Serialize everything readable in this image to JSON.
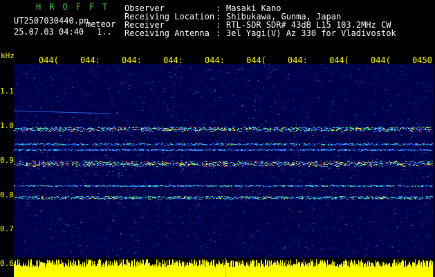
{
  "header": {
    "title": "HROFFT",
    "filename": "UT2507030440.pn",
    "filename_suffix": "meteor",
    "datetime": "25.07.03 04:40",
    "count": "1..",
    "info": [
      {
        "label": "Observer",
        "value": "Masaki Kano"
      },
      {
        "label": "Receiving Location",
        "value": "Shibukawa, Gunma, Japan"
      },
      {
        "label": "Receiver",
        "value": "RTL-SDR SDR# 43dB L15 103.2MHz CW"
      },
      {
        "label": "Receiving Antenna",
        "value": "3el Yagi(V) Az 330 for Vladivostok"
      }
    ]
  },
  "axis": {
    "y_unit": "kHz",
    "y_ticks": [
      "1.1",
      "1.0",
      "0.9",
      "0.8",
      "0.7",
      "0.6"
    ],
    "x_ticks": [
      "044(",
      "044:",
      "044:",
      "044:",
      "044:",
      "044(",
      "044:",
      "044(",
      "044(",
      "0450"
    ]
  },
  "colors": {
    "text": "#ffffff",
    "accent": "#3dd23d",
    "axis": "#ffff00",
    "background": "#000000"
  }
}
